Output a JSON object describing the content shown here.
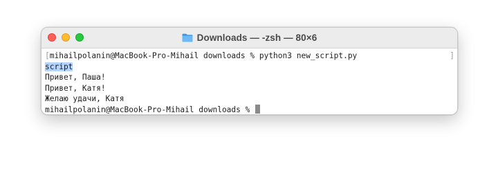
{
  "window": {
    "title": "Downloads — -zsh — 80×6",
    "title_icon": "folder-icon"
  },
  "terminal": {
    "mark_open": "[",
    "mark_close": "]",
    "lines": [
      "mihailpolanin@MacBook-Pro-Mihail downloads % python3 new_script.py",
      "script",
      "Привет, Паша!",
      "Привет, Катя!",
      "Желаю удачи, Катя",
      "mihailpolanin@MacBook-Pro-Mihail downloads % "
    ],
    "selected_line_index": 1
  },
  "colors": {
    "close": "#ff5f57",
    "minimize": "#febc2e",
    "zoom": "#28c840",
    "folder": "#5aaef0",
    "selection": "#b4d4fd"
  }
}
